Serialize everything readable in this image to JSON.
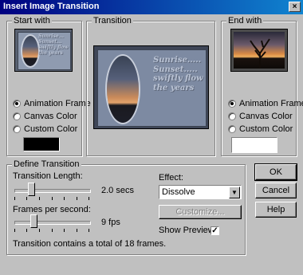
{
  "window": {
    "title": "Insert Image Transition",
    "close_glyph": "×"
  },
  "start_with": {
    "legend": "Start with",
    "thumb_text": [
      "Sunrise...",
      "Sunset...",
      "swiftly flow",
      "the years"
    ],
    "options": [
      {
        "label": "Animation Frame",
        "selected": true
      },
      {
        "label": "Canvas Color",
        "selected": false
      },
      {
        "label": "Custom Color",
        "selected": false
      }
    ],
    "custom_color": "#000000"
  },
  "transition": {
    "legend": "Transition",
    "preview_text": [
      "Sunrise.....",
      "Sunset.....",
      "swiftly flow",
      "the years"
    ]
  },
  "end_with": {
    "legend": "End with",
    "options": [
      {
        "label": "Animation Frame",
        "selected": true
      },
      {
        "label": "Canvas Color",
        "selected": false
      },
      {
        "label": "Custom Color",
        "selected": false
      }
    ],
    "custom_color": "#ffffff"
  },
  "define": {
    "legend": "Define Transition",
    "length_label": "Transition Length:",
    "length_value": "2.0 secs",
    "length_fraction": 0.2,
    "fps_label": "Frames per second:",
    "fps_value": "9 fps",
    "fps_fraction": 0.24,
    "summary": "Transition contains a total of 18 frames.",
    "effect_label": "Effect:",
    "effect_value": "Dissolve",
    "customize_label": "Customize...",
    "show_preview_label": "Show Preview",
    "show_preview_checked": true
  },
  "buttons": {
    "ok": "OK",
    "cancel": "Cancel",
    "help": "Help"
  },
  "colors": {
    "titlebar": "#000080",
    "face": "#c0c0c0"
  }
}
